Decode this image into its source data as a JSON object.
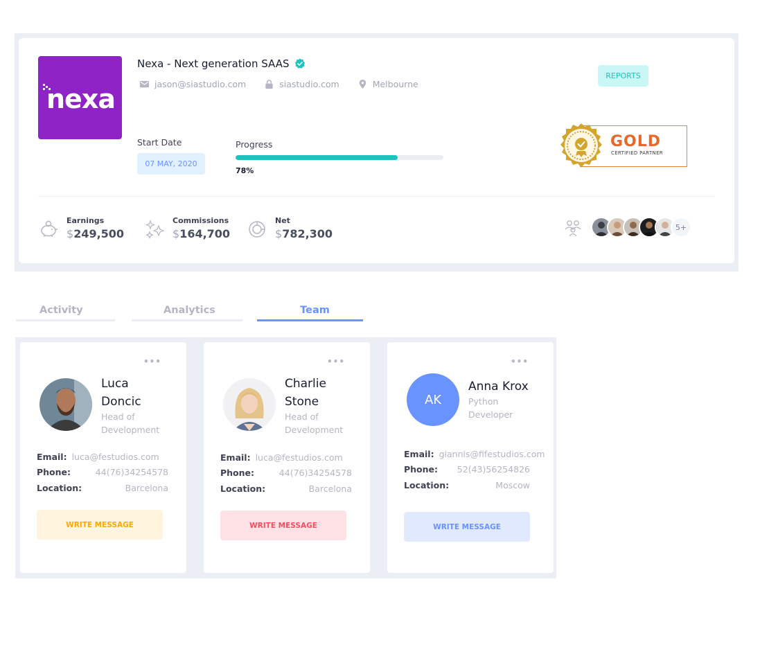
{
  "company": {
    "logo_text": "nexa",
    "name": "Nexa - Next generation SAAS",
    "email": "jason@siastudio.com",
    "website": "siastudio.com",
    "location": "Melbourne",
    "reports_label": "REPORTS",
    "start_date_label": "Start Date",
    "start_date": "07 MAY, 2020",
    "progress_label": "Progress",
    "progress_percent": 78,
    "progress_text": "78%",
    "badge": {
      "title": "GOLD",
      "subtitle": "CERTIFIED PARTNER",
      "color": "#e6692b"
    }
  },
  "stats": [
    {
      "label": "Earnings",
      "currency": "$",
      "value": "249,500",
      "icon": "piggy-bank-icon"
    },
    {
      "label": "Commissions",
      "currency": "$",
      "value": "164,700",
      "icon": "sparkles-icon"
    },
    {
      "label": "Net",
      "currency": "$",
      "value": "782,300",
      "icon": "pie-chart-icon"
    }
  ],
  "members_more": "5+",
  "tabs": [
    {
      "label": "Activity",
      "active": false
    },
    {
      "label": "Analytics",
      "active": false
    },
    {
      "label": "Team",
      "active": true
    }
  ],
  "team": [
    {
      "name_line1": "Luca",
      "name_line2": "Doncic",
      "role_line1": "Head of",
      "role_line2": "Development",
      "email_label": "Email:",
      "email": "luca@festudios.com",
      "phone_label": "Phone:",
      "phone": "44(76)34254578",
      "location_label": "Location:",
      "location": "Barcelona",
      "button": "WRITE MESSAGE",
      "button_bg": "#fff4de",
      "button_color": "#ffa800"
    },
    {
      "name_line1": "Charlie",
      "name_line2": "Stone",
      "role_line1": "Head of",
      "role_line2": "Development",
      "email_label": "Email:",
      "email": "luca@festudios.com",
      "phone_label": "Phone:",
      "phone": "44(76)34254578",
      "location_label": "Location:",
      "location": "Barcelona",
      "button": "WRITE MESSAGE",
      "button_bg": "#ffe2e5",
      "button_color": "#f64e60"
    },
    {
      "initials": "AK",
      "name_line1": "Anna Krox",
      "role_line1": "Python",
      "role_line2": "Developer",
      "email_label": "Email:",
      "email": "giannis@fifestudios.com",
      "phone_label": "Phone:",
      "phone": "52(43)56254826",
      "location_label": "Location:",
      "location": "Moscow",
      "button": "WRITE MESSAGE",
      "button_bg": "#e1e9ff",
      "button_color": "#6993ff"
    }
  ]
}
